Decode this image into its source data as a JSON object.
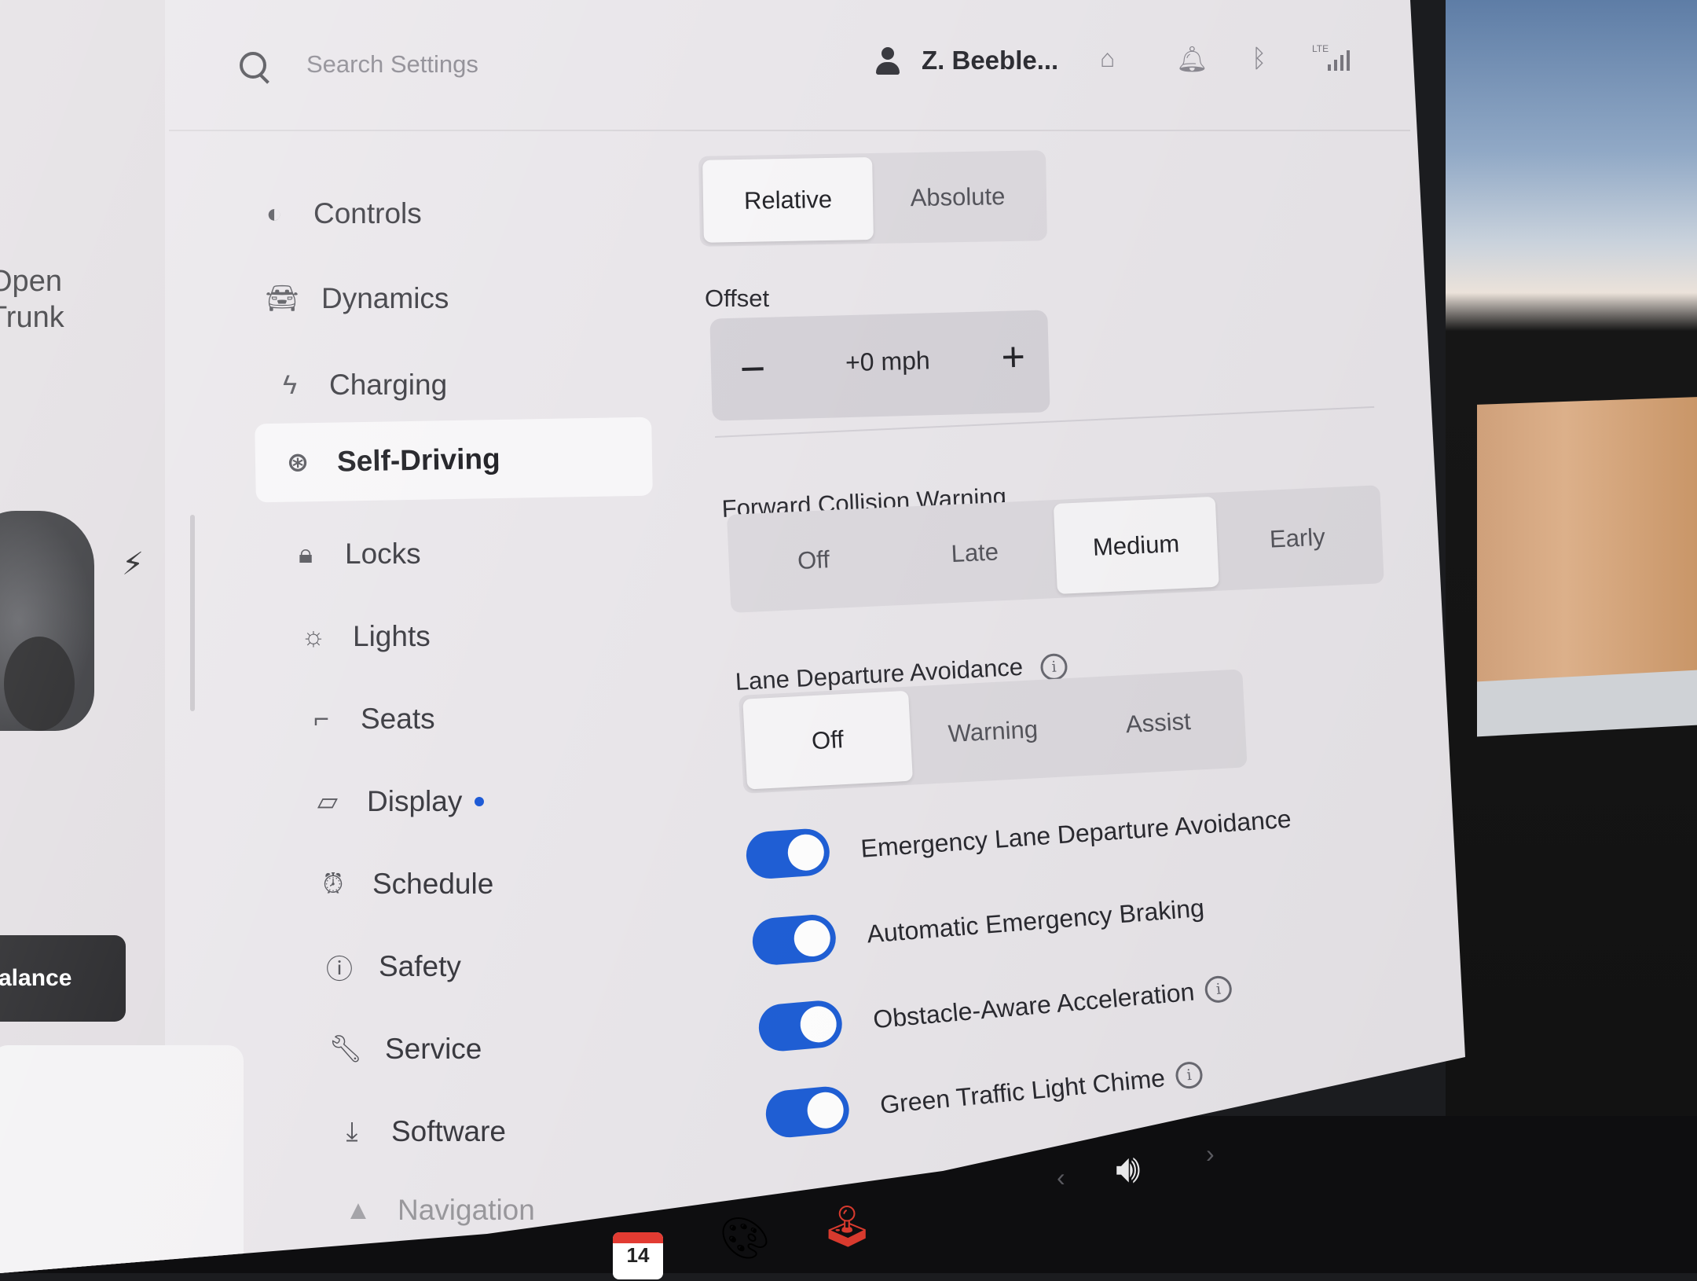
{
  "header": {
    "search_placeholder": "Search Settings",
    "user_name": "Z. Beeble...",
    "network": "LTE"
  },
  "left_panel": {
    "trunk_line1": "Open",
    "trunk_line2": "Trunk",
    "balance_label": "alance"
  },
  "sidebar": {
    "items": [
      {
        "label": "Controls",
        "icon": "toggle-icon"
      },
      {
        "label": "Dynamics",
        "icon": "car-icon"
      },
      {
        "label": "Charging",
        "icon": "bolt-icon"
      },
      {
        "label": "Self-Driving",
        "icon": "steering-wheel-icon",
        "active": true
      },
      {
        "label": "Locks",
        "icon": "lock-icon"
      },
      {
        "label": "Lights",
        "icon": "sun-icon"
      },
      {
        "label": "Seats",
        "icon": "seat-icon"
      },
      {
        "label": "Display",
        "icon": "display-icon",
        "badge": true
      },
      {
        "label": "Schedule",
        "icon": "alarm-clock-icon"
      },
      {
        "label": "Safety",
        "icon": "alert-icon"
      },
      {
        "label": "Service",
        "icon": "wrench-icon"
      },
      {
        "label": "Software",
        "icon": "download-icon"
      },
      {
        "label": "Navigation",
        "icon": "navigation-icon"
      }
    ]
  },
  "speed_limit": {
    "options": [
      "Relative",
      "Absolute"
    ],
    "selected": "Relative",
    "offset_label": "Offset",
    "offset_value": "+0 mph",
    "minus": "−",
    "plus": "+"
  },
  "forward_collision": {
    "label": "Forward Collision Warning",
    "options": [
      "Off",
      "Late",
      "Medium",
      "Early"
    ],
    "selected": "Medium"
  },
  "lane_departure": {
    "label": "Lane Departure Avoidance",
    "options": [
      "Off",
      "Warning",
      "Assist"
    ],
    "selected": "Off"
  },
  "toggles": [
    {
      "label": "Emergency Lane Departure Avoidance",
      "on": true,
      "info": false
    },
    {
      "label": "Automatic Emergency Braking",
      "on": true,
      "info": false
    },
    {
      "label": "Obstacle-Aware Acceleration",
      "on": true,
      "info": true
    },
    {
      "label": "Green Traffic Light Chime",
      "on": true,
      "info": true
    }
  ],
  "taskbar": {
    "calendar_day": "14"
  },
  "colors": {
    "accent": "#1f5fd6",
    "screen_bg": "#e9e6ea"
  }
}
